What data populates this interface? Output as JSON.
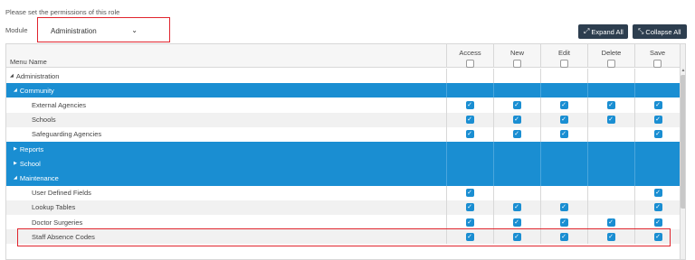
{
  "instruction": "Please set the permissions of this role",
  "module": {
    "label": "Module",
    "selected": "Administration"
  },
  "toolbar": {
    "expand_all": "Expand All",
    "collapse_all": "Collapse All"
  },
  "table": {
    "headers": {
      "menu_name": "Menu Name",
      "access": "Access",
      "new": "New",
      "edit": "Edit",
      "delete": "Delete",
      "save": "Save"
    },
    "rows": [
      {
        "label": "Administration",
        "level": 0,
        "style": "white",
        "expander": "collapse",
        "checks": [
          null,
          null,
          null,
          null,
          null
        ]
      },
      {
        "label": "Community",
        "level": 1,
        "style": "blue",
        "expander": "collapse",
        "checks": [
          null,
          null,
          null,
          null,
          null
        ]
      },
      {
        "label": "External Agencies",
        "level": 2,
        "style": "white",
        "checks": [
          true,
          true,
          true,
          true,
          true
        ]
      },
      {
        "label": "Schools",
        "level": 2,
        "style": "grey",
        "checks": [
          true,
          true,
          true,
          true,
          true
        ]
      },
      {
        "label": "Safeguarding Agencies",
        "level": 2,
        "style": "white",
        "checks": [
          true,
          true,
          true,
          false,
          true
        ]
      },
      {
        "label": "Reports",
        "level": 1,
        "style": "blue",
        "expander": "expand",
        "checks": [
          null,
          null,
          null,
          null,
          null
        ]
      },
      {
        "label": "School",
        "level": 1,
        "style": "blue",
        "expander": "expand",
        "checks": [
          null,
          null,
          null,
          null,
          null
        ]
      },
      {
        "label": "Maintenance",
        "level": 1,
        "style": "blue",
        "expander": "collapse",
        "checks": [
          null,
          null,
          null,
          null,
          null
        ]
      },
      {
        "label": "User Defined Fields",
        "level": 2,
        "style": "white",
        "checks": [
          true,
          false,
          false,
          false,
          true
        ]
      },
      {
        "label": "Lookup Tables",
        "level": 2,
        "style": "grey",
        "checks": [
          true,
          true,
          true,
          false,
          true
        ]
      },
      {
        "label": "Doctor Surgeries",
        "level": 2,
        "style": "white",
        "checks": [
          true,
          true,
          true,
          true,
          true
        ]
      },
      {
        "label": "Staff Absence Codes",
        "level": 2,
        "style": "grey",
        "checks": [
          true,
          true,
          true,
          true,
          true
        ]
      }
    ]
  },
  "colors": {
    "accent": "#1a8ed2",
    "button": "#2d3e4f",
    "highlight": "#e0242d"
  }
}
